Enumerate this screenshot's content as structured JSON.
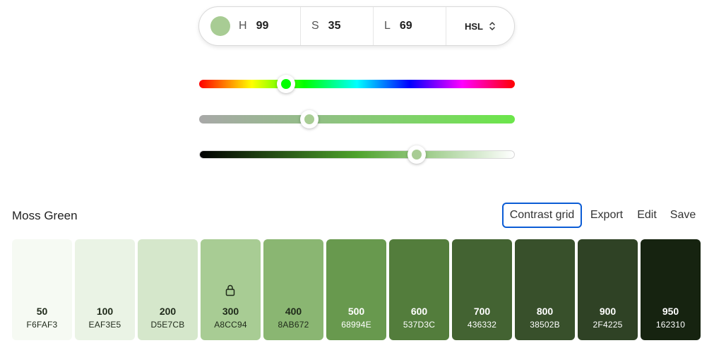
{
  "picker": {
    "swatch_color": "#A8CC94",
    "h_label": "H",
    "h_value": "99",
    "s_label": "S",
    "s_value": "35",
    "l_label": "L",
    "l_value": "69",
    "mode": "HSL"
  },
  "sliders": {
    "hue": {
      "value": 99,
      "max": 360,
      "thumb_color": "#00ff00"
    },
    "saturation": {
      "value": 35,
      "max": 100,
      "thumb_color": "#A8CC94"
    },
    "lightness": {
      "value": 69,
      "max": 100,
      "thumb_color": "#A8CC94"
    }
  },
  "palette": {
    "name": "Moss Green",
    "actions": {
      "contrast_grid": "Contrast grid",
      "export": "Export",
      "edit": "Edit",
      "save": "Save"
    },
    "swatches": [
      {
        "shade": "50",
        "hex": "F6FAF3",
        "color": "#F6FAF3",
        "text": "#1f2a1a"
      },
      {
        "shade": "100",
        "hex": "EAF3E5",
        "color": "#EAF3E5",
        "text": "#1f2a1a"
      },
      {
        "shade": "200",
        "hex": "D5E7CB",
        "color": "#D5E7CB",
        "text": "#1f2a1a"
      },
      {
        "shade": "300",
        "hex": "A8CC94",
        "color": "#A8CC94",
        "text": "#1f2a1a",
        "locked": true
      },
      {
        "shade": "400",
        "hex": "8AB672",
        "color": "#8AB672",
        "text": "#1f2a1a"
      },
      {
        "shade": "500",
        "hex": "68994E",
        "color": "#68994E",
        "text": "#ffffff"
      },
      {
        "shade": "600",
        "hex": "537D3C",
        "color": "#537D3C",
        "text": "#ffffff"
      },
      {
        "shade": "700",
        "hex": "436332",
        "color": "#436332",
        "text": "#ffffff"
      },
      {
        "shade": "800",
        "hex": "38502B",
        "color": "#38502B",
        "text": "#ffffff"
      },
      {
        "shade": "900",
        "hex": "2F4225",
        "color": "#2F4225",
        "text": "#ffffff"
      },
      {
        "shade": "950",
        "hex": "162310",
        "color": "#162310",
        "text": "#ffffff"
      }
    ]
  }
}
